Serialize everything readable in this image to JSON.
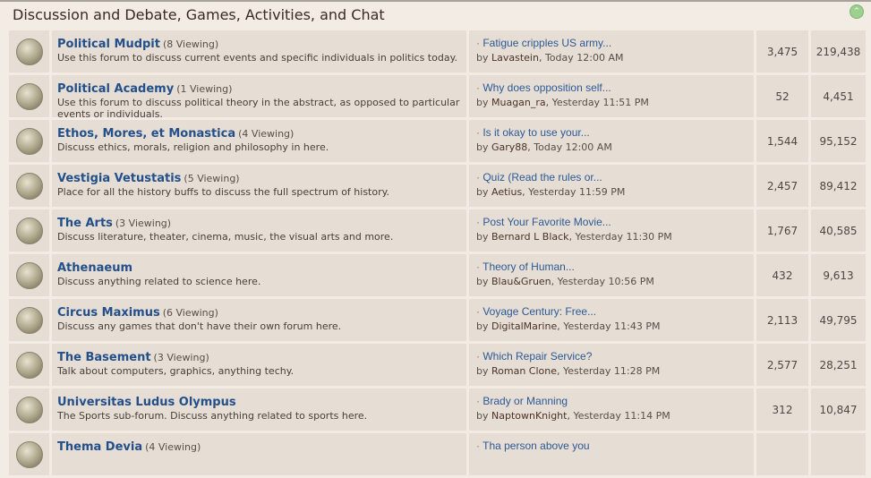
{
  "category": {
    "title": "Discussion and Debate, Games, Activities, and Chat"
  },
  "forums": [
    {
      "name": "Political Mudpit",
      "viewing": "(8 Viewing)",
      "desc": "Use this forum to discuss current events and specific individuals in politics today.",
      "last_title": "Fatigue cripples US army...",
      "last_by": "by ",
      "last_user": "Lavastein",
      "last_time": ", Today 12:00 AM",
      "threads": "3,475",
      "posts": "219,438"
    },
    {
      "name": "Political Academy",
      "viewing": "(1 Viewing)",
      "desc": "Use this forum to discuss political theory in the abstract, as opposed to particular events or individuals.",
      "last_title": "Why does opposition self...",
      "last_by": "by ",
      "last_user": "Muagan_ra",
      "last_time": ", Yesterday 11:51 PM",
      "threads": "52",
      "posts": "4,451"
    },
    {
      "name": "Ethos, Mores, et Monastica",
      "viewing": "(4 Viewing)",
      "desc": "Discuss ethics, morals, religion and philosophy in here.",
      "last_title": "Is it okay to use your...",
      "last_by": "by ",
      "last_user": "Gary88",
      "last_time": ", Today 12:00 AM",
      "threads": "1,544",
      "posts": "95,152"
    },
    {
      "name": "Vestigia Vetustatis",
      "viewing": "(5 Viewing)",
      "desc": "Place for all the history buffs to discuss the full spectrum of history.",
      "last_title": "Quiz (Read the rules or...",
      "last_by": "by ",
      "last_user": "Aetius",
      "last_time": ", Yesterday 11:59 PM",
      "threads": "2,457",
      "posts": "89,412"
    },
    {
      "name": "The Arts",
      "viewing": "(3 Viewing)",
      "desc": "Discuss literature, theater, cinema, music, the visual arts and more.",
      "last_title": "Post Your Favorite Movie...",
      "last_by": "by ",
      "last_user": "Bernard L Black",
      "last_time": ", Yesterday 11:30 PM",
      "threads": "1,767",
      "posts": "40,585"
    },
    {
      "name": "Athenaeum",
      "viewing": "",
      "desc": "Discuss anything related to science here.",
      "last_title": "Theory of Human...",
      "last_by": "by ",
      "last_user": "Blau&Gruen",
      "last_time": ", Yesterday 10:56 PM",
      "threads": "432",
      "posts": "9,613"
    },
    {
      "name": "Circus Maximus",
      "viewing": "(6 Viewing)",
      "desc": "Discuss any games that don't have their own forum here.",
      "last_title": "Voyage Century: Free...",
      "last_by": "by ",
      "last_user": "DigitalMarine",
      "last_time": ", Yesterday 11:43 PM",
      "threads": "2,113",
      "posts": "49,795"
    },
    {
      "name": "The Basement",
      "viewing": "(3 Viewing)",
      "desc": "Talk about computers, graphics, anything techy.",
      "last_title": "Which Repair Service?",
      "last_by": "by ",
      "last_user": "Roman Clone",
      "last_time": ", Yesterday 11:28 PM",
      "threads": "2,577",
      "posts": "28,251"
    },
    {
      "name": "Universitas Ludus Olympus",
      "viewing": "",
      "desc": "The Sports sub-forum. Discuss anything related to sports here.",
      "last_title": "Brady or Manning",
      "last_by": "by ",
      "last_user": "NaptownKnight",
      "last_time": ", Yesterday 11:14 PM",
      "threads": "312",
      "posts": "10,847"
    },
    {
      "name": "Thema Devia",
      "viewing": "(4 Viewing)",
      "desc": "",
      "last_title": "Tha person above you",
      "last_by": "",
      "last_user": "",
      "last_time": "",
      "threads": "",
      "posts": ""
    }
  ]
}
